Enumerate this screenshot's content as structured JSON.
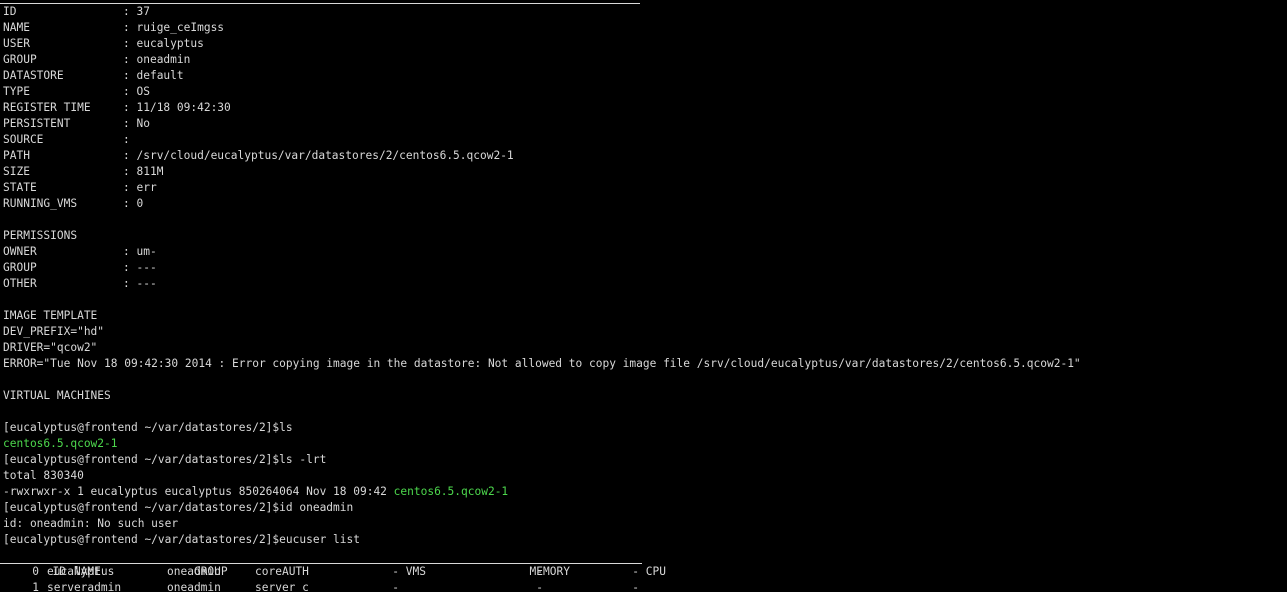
{
  "image_info": [
    {
      "key": "ID",
      "value": "37"
    },
    {
      "key": "NAME",
      "value": "ruige_ceImgss"
    },
    {
      "key": "USER",
      "value": "eucalyptus"
    },
    {
      "key": "GROUP",
      "value": "oneadmin"
    },
    {
      "key": "DATASTORE",
      "value": "default"
    },
    {
      "key": "TYPE",
      "value": "OS"
    },
    {
      "key": "REGISTER TIME",
      "value": "11/18 09:42:30"
    },
    {
      "key": "PERSISTENT",
      "value": "No"
    },
    {
      "key": "SOURCE",
      "value": ""
    },
    {
      "key": "PATH",
      "value": "/srv/cloud/eucalyptus/var/datastores/2/centos6.5.qcow2-1"
    },
    {
      "key": "SIZE",
      "value": "811M"
    },
    {
      "key": "STATE",
      "value": "err"
    },
    {
      "key": "RUNNING_VMS",
      "value": "0"
    }
  ],
  "permissions": {
    "title": "PERMISSIONS",
    "rows": [
      {
        "key": "OWNER",
        "value": "um-"
      },
      {
        "key": "GROUP",
        "value": "---"
      },
      {
        "key": "OTHER",
        "value": "---"
      }
    ]
  },
  "image_template": {
    "title": "IMAGE TEMPLATE",
    "lines": [
      "DEV_PREFIX=\"hd\"",
      "DRIVER=\"qcow2\"",
      "ERROR=\"Tue Nov 18 09:42:30 2014 : Error copying image in the datastore: Not allowed to copy image file /srv/cloud/eucalyptus/var/datastores/2/centos6.5.qcow2-1\""
    ]
  },
  "virtual_machines_title": "VIRTUAL MACHINES",
  "shell": {
    "prompt": "[eucalyptus@frontend ~/var/datastores/2]$",
    "cmd1": "ls",
    "ls_output": "centos6.5.qcow2-1",
    "cmd2": "ls -lrt",
    "total": "total 830340",
    "lrt_prefix": "-rwxrwxr-x 1 eucalyptus eucalyptus 850264064 Nov 18 09:42 ",
    "lrt_file": "centos6.5.qcow2-1",
    "cmd3": "id oneadmin",
    "id_output": "id: oneadmin: No such user",
    "cmd4": "eucuser list"
  },
  "user_table": {
    "headers": {
      "id": "ID",
      "name": "NAME",
      "group": "GROUP",
      "auth": "AUTH",
      "vms": "VMS",
      "memory": "MEMORY",
      "cpu": "CPU"
    },
    "rows": [
      {
        "id": "0",
        "name": "eucalyptus",
        "group": "oneadmin",
        "auth": "core",
        "vms": "-",
        "memory": "-",
        "cpu": "-"
      },
      {
        "id": "1",
        "name": "serveradmin",
        "group": "oneadmin",
        "auth": "server_c",
        "vms": "-",
        "memory": "-",
        "cpu": "-"
      }
    ]
  }
}
